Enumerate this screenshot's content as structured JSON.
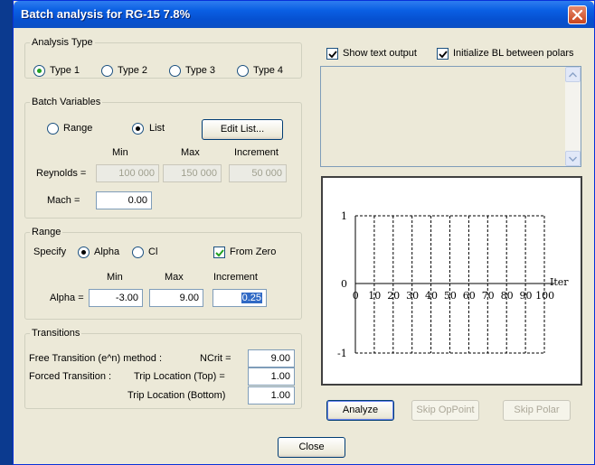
{
  "window": {
    "title": "Batch analysis for RG-15 7.8%"
  },
  "analysis_type": {
    "legend": "Analysis Type",
    "options": [
      "Type 1",
      "Type 2",
      "Type 3",
      "Type 4"
    ],
    "selected": "Type 1"
  },
  "batch_variables": {
    "legend": "Batch Variables",
    "range_label": "Range",
    "list_label": "List",
    "selected": "List",
    "edit_list_button": "Edit List...",
    "col_min": "Min",
    "col_max": "Max",
    "col_increment": "Increment",
    "reynolds_label": "Reynolds =",
    "reynolds_min": "100 000",
    "reynolds_max": "150 000",
    "reynolds_increment": "50 000",
    "mach_label": "Mach =",
    "mach_value": "0.00"
  },
  "range": {
    "legend": "Range",
    "specify_label": "Specify",
    "alpha_label": "Alpha",
    "cl_label": "Cl",
    "selected": "Alpha",
    "from_zero_label": "From Zero",
    "from_zero_checked": true,
    "col_min": "Min",
    "col_max": "Max",
    "col_increment": "Increment",
    "alpha_eq_label": "Alpha =",
    "alpha_min": "-3.00",
    "alpha_max": "9.00",
    "alpha_increment": "0.25"
  },
  "transitions": {
    "legend": "Transitions",
    "free_label": "Free Transition (e^n) method :",
    "ncrit_label": "NCrit =",
    "ncrit_value": "9.00",
    "forced_label": "Forced Transition :",
    "trip_top_label": "Trip Location (Top) =",
    "trip_top_value": "1.00",
    "trip_bottom_label": "Trip Location (Bottom)",
    "trip_bottom_value": "1.00"
  },
  "options": {
    "show_text_output_label": "Show text output",
    "show_text_output_checked": true,
    "init_bl_label": "Initialize BL between polars",
    "init_bl_checked": true
  },
  "graph": {
    "y_ticks": [
      "1",
      "0",
      "-1"
    ],
    "x_ticks": [
      "0",
      "10",
      "20",
      "30",
      "40",
      "50",
      "60",
      "70",
      "80",
      "90",
      "100"
    ],
    "x_label": "Iter"
  },
  "buttons": {
    "analyze": "Analyze",
    "skip_oppoint": "Skip OpPoint",
    "skip_polar": "Skip Polar",
    "close": "Close"
  },
  "icons": [
    "close-icon",
    "scroll-up-icon",
    "scroll-down-icon",
    "checkmark-icon"
  ],
  "colors": {
    "titlebar": "#0a5fe3",
    "dialog_bg": "#ece9d8",
    "selection": "#316ac5"
  }
}
